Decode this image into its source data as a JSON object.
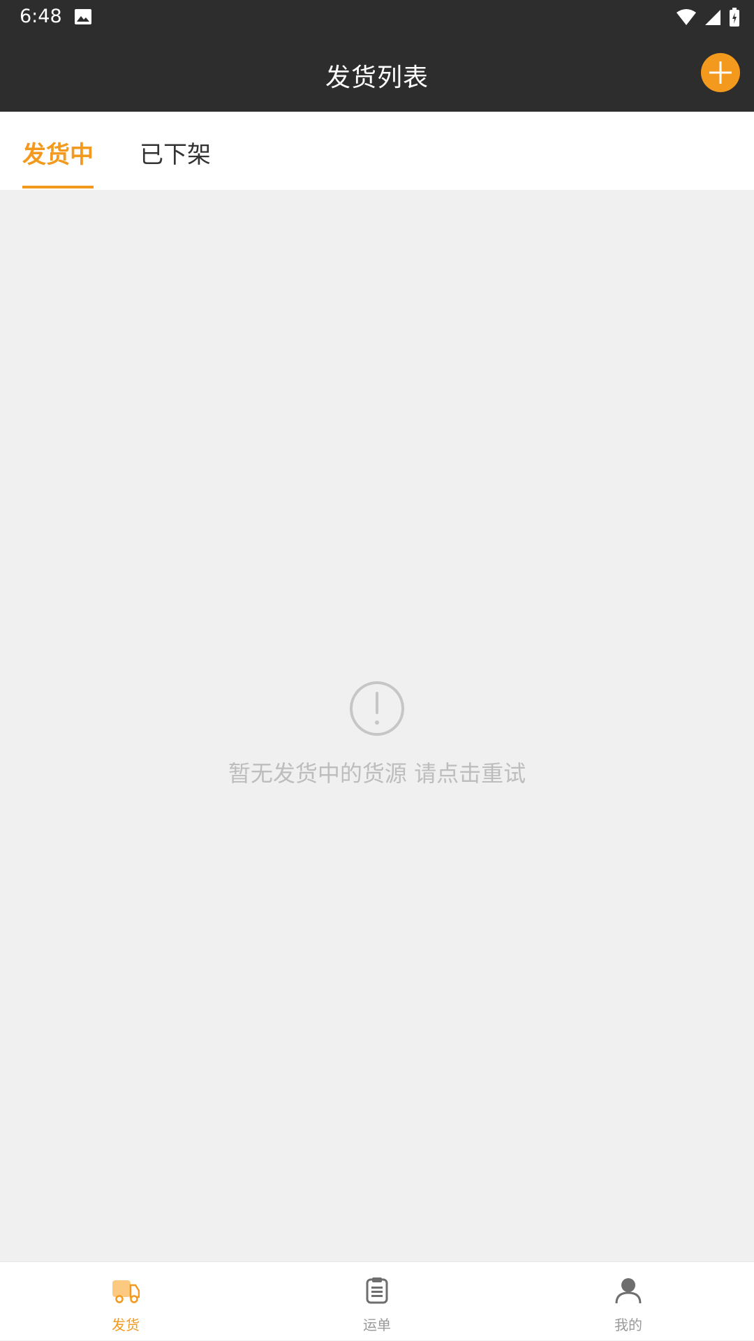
{
  "status_bar": {
    "time": "6:48"
  },
  "app_bar": {
    "title": "发货列表"
  },
  "tabs": [
    {
      "label": "发货中",
      "active": true
    },
    {
      "label": "已下架",
      "active": false
    }
  ],
  "empty_state": {
    "message": "暂无发货中的货源 请点击重试"
  },
  "bottom_nav": [
    {
      "label": "发货",
      "icon": "truck-icon",
      "active": true
    },
    {
      "label": "运单",
      "icon": "clipboard-icon",
      "active": false
    },
    {
      "label": "我的",
      "icon": "person-icon",
      "active": false
    }
  ],
  "colors": {
    "accent": "#f39a1e",
    "header": "#2d2d2d",
    "background": "#f0f0f0"
  }
}
